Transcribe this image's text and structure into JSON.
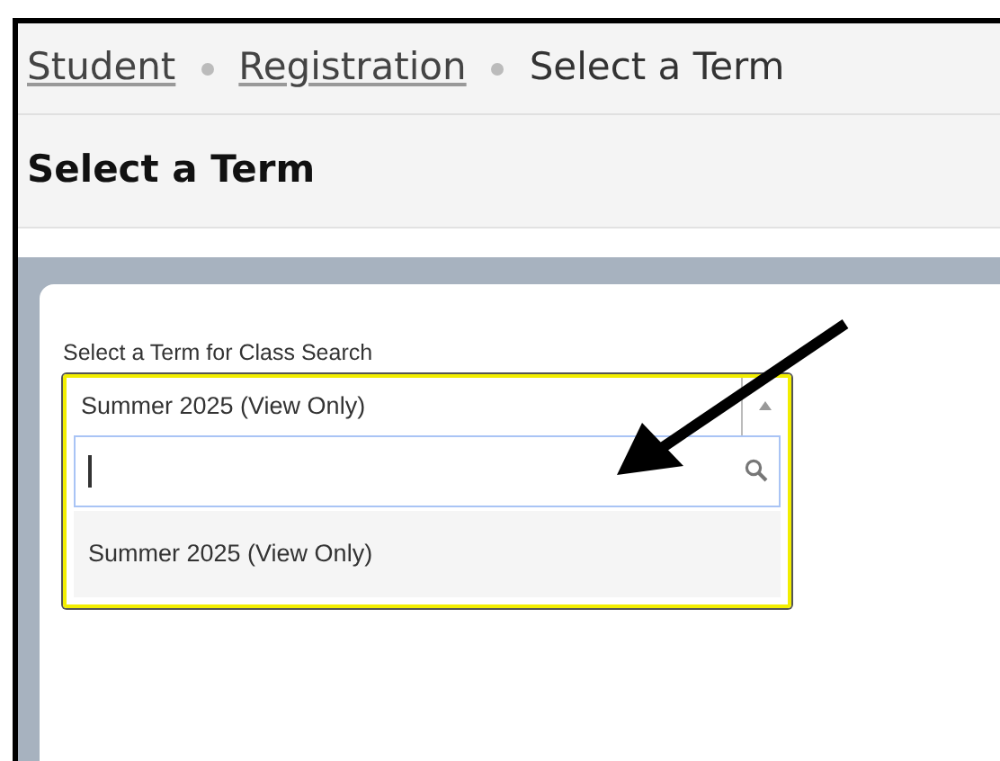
{
  "breadcrumbs": [
    {
      "label": "Student",
      "kind": "link"
    },
    {
      "label": "Registration",
      "kind": "link"
    },
    {
      "label": "Select a Term",
      "kind": "current"
    }
  ],
  "page_title": "Select a Term",
  "term_field": {
    "label": "Select a Term for Class Search",
    "value": "Summer 2025 (View Only)",
    "expanded": true,
    "options": [
      {
        "label": "Summer 2025 (View Only)"
      }
    ]
  }
}
